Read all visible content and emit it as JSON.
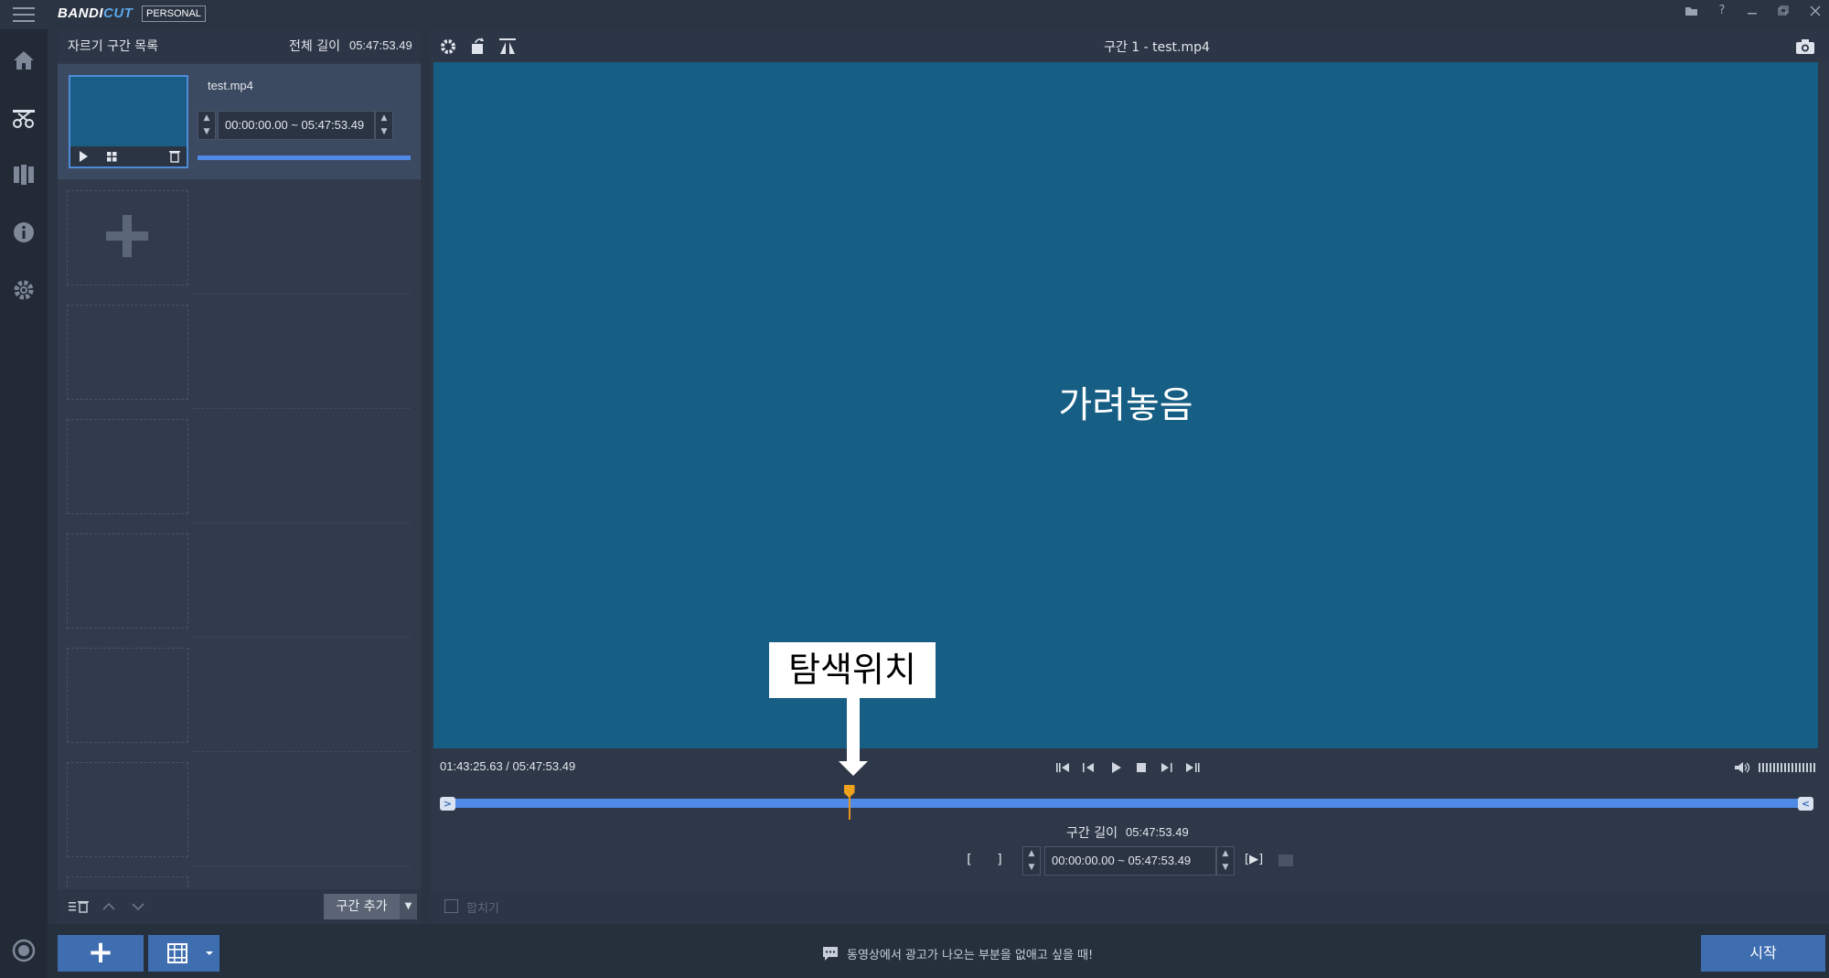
{
  "app": {
    "logo_main": "BANDI",
    "logo_accent": "CUT",
    "edition": "PERSONAL"
  },
  "window_controls": [
    "folder-icon",
    "help-icon",
    "minimize-icon",
    "restore-icon",
    "close-icon"
  ],
  "sidebar": {
    "items": [
      "home-icon",
      "cut-icon",
      "join-icon",
      "info-icon",
      "settings-icon"
    ],
    "bottom": "record-icon"
  },
  "cut_list": {
    "title": "자르기 구간 목록",
    "total_label": "전체 길이",
    "total_value": "05:47:53.49",
    "items": [
      {
        "name": "test.mp4",
        "range": "00:00:00.00  ~  05:47:53.49",
        "progress": 1.0
      }
    ],
    "add_section_label": "구간 추가"
  },
  "preview": {
    "title": "구간 1 - test.mp4",
    "hidden_label": "가려놓음",
    "annotation": "탐색위치",
    "time_readout": "01:43:25.63  /  05:47:53.49",
    "playhead_fraction": 0.297,
    "segment_length_label": "구간 길이",
    "segment_length_value": "05:47:53.49",
    "segment_range": "00:00:00.00   ~   05:47:53.49",
    "merge_label": "합치기"
  },
  "bottom": {
    "add_label": "+",
    "tip": "동영상에서 광고가 나오는 부분을 없애고 싶을 때!",
    "start_label": "시작"
  },
  "colors": {
    "accent": "#4f8ae6",
    "video_bg": "#175e84",
    "playhead": "#f0a21d",
    "button": "#3f6eb0"
  }
}
